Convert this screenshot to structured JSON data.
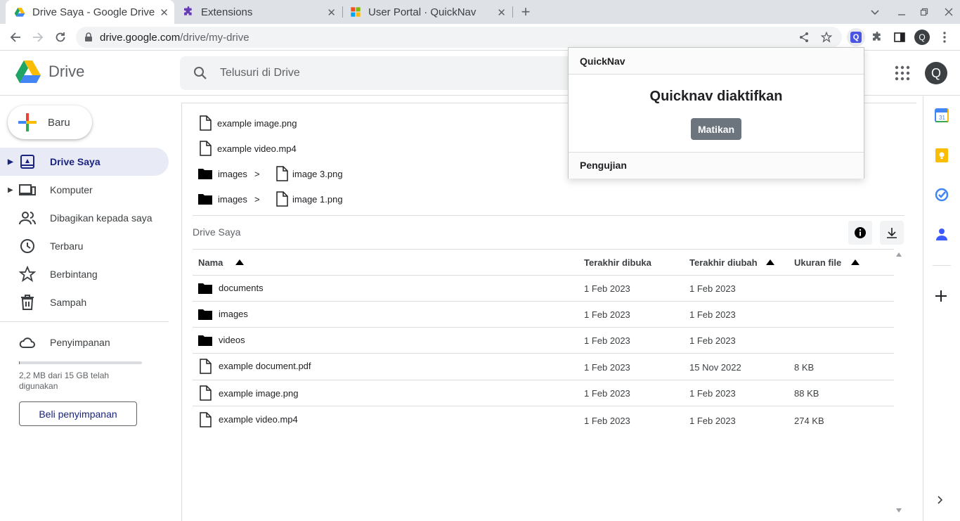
{
  "browser": {
    "tabs": [
      {
        "title": "Drive Saya - Google Drive",
        "favicon": "google-drive-favicon",
        "active": true
      },
      {
        "title": "Extensions",
        "favicon": "puzzle-favicon",
        "active": false
      },
      {
        "title": "User Portal · QuickNav",
        "favicon": "microsoft-favicon",
        "active": false
      }
    ],
    "new_tab_label": "+",
    "url_host": "drive.google.com",
    "url_path": "/drive/my-drive",
    "profile_initial": "Q"
  },
  "drive": {
    "logo_text": "Drive",
    "search_placeholder": "Telusuri di Drive",
    "new_button": "Baru",
    "account_initial": "Q",
    "nav": [
      {
        "label": "Drive Saya",
        "icon": "my-drive-icon",
        "active": true,
        "expandable": true
      },
      {
        "label": "Komputer",
        "icon": "computer-icon",
        "active": false,
        "expandable": true
      },
      {
        "label": "Dibagikan kepada saya",
        "icon": "shared-people-icon",
        "active": false,
        "expandable": false
      },
      {
        "label": "Terbaru",
        "icon": "clock-icon",
        "active": false,
        "expandable": false
      },
      {
        "label": "Berbintang",
        "icon": "star-icon",
        "active": false,
        "expandable": false
      },
      {
        "label": "Sampah",
        "icon": "trash-icon",
        "active": false,
        "expandable": false
      }
    ],
    "storage": {
      "label": "Penyimpanan",
      "usage_text": "2,2 MB dari 15 GB telah digunakan",
      "used_fraction": 0.0001,
      "buy_label": "Beli penyimpanan"
    }
  },
  "quick_access": [
    {
      "folder": "",
      "name": "example image.png"
    },
    {
      "folder": "",
      "name": "example video.mp4"
    },
    {
      "folder": "images",
      "sep": ">",
      "name": "image 3.png"
    },
    {
      "folder": "images",
      "sep": ">",
      "name": "image 1.png"
    }
  ],
  "section_title": "Drive Saya",
  "table": {
    "headers": {
      "name": "Nama",
      "opened": "Terakhir dibuka",
      "modified": "Terakhir diubah",
      "size": "Ukuran file"
    },
    "rows": [
      {
        "type": "folder",
        "name": "documents",
        "opened": "1 Feb 2023",
        "modified": "1 Feb 2023",
        "size": ""
      },
      {
        "type": "folder",
        "name": "images",
        "opened": "1 Feb 2023",
        "modified": "1 Feb 2023",
        "size": ""
      },
      {
        "type": "folder",
        "name": "videos",
        "opened": "1 Feb 2023",
        "modified": "1 Feb 2023",
        "size": ""
      },
      {
        "type": "file",
        "name": "example document.pdf",
        "opened": "1 Feb 2023",
        "modified": "15 Nov 2022",
        "size": "8 KB"
      },
      {
        "type": "file",
        "name": "example image.png",
        "opened": "1 Feb 2023",
        "modified": "1 Feb 2023",
        "size": "88 KB"
      },
      {
        "type": "file",
        "name": "example video.mp4",
        "opened": "1 Feb 2023",
        "modified": "1 Feb 2023",
        "size": "274 KB"
      }
    ]
  },
  "popup": {
    "header": "QuickNav",
    "status": "Quicknav diaktifkan",
    "button": "Matikan",
    "footer": "Pengujian"
  }
}
